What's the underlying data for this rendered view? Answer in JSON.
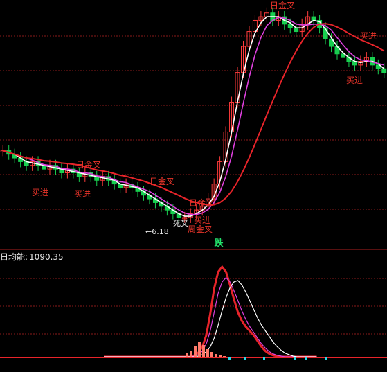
{
  "colors": {
    "background": "#000000",
    "grid": "#8a1a1a",
    "up_candle": "#ff3b3b",
    "down_candle": "#18d050",
    "white_line": "#ffffff",
    "magenta_line": "#e040e0",
    "red_line": "#e8242a",
    "label_red": "#e8342a",
    "volume_bar": "#ff7a6a",
    "volume_neg": "#2ad8e8",
    "marker_green": "#22e06a"
  },
  "indicator": {
    "name": "日均能:",
    "value": "1090.35"
  },
  "marker": {
    "text": "跌"
  },
  "annotations": {
    "low_price": "←6.18",
    "golden_cross": "日金叉",
    "weekly_golden_cross": "周金叉",
    "buy": "买进",
    "death_cross": "死叉"
  },
  "chart_data": [
    {
      "type": "candlestick",
      "title": "",
      "series": [
        {
          "name": "",
          "color": "white_line"
        },
        {
          "name": "",
          "color": "magenta_line"
        },
        {
          "name": "",
          "color": "red_line"
        }
      ],
      "close": [
        8.1,
        8.0,
        7.9,
        7.8,
        7.7,
        7.8,
        7.7,
        7.6,
        7.7,
        7.6,
        7.5,
        7.6,
        7.5,
        7.4,
        7.5,
        7.4,
        7.3,
        7.4,
        7.3,
        7.2,
        7.1,
        7.2,
        7.1,
        7.0,
        6.9,
        6.8,
        6.7,
        6.6,
        6.5,
        6.4,
        6.3,
        6.3,
        6.4,
        6.5,
        6.6,
        6.8,
        7.2,
        7.8,
        8.6,
        9.4,
        10.2,
        10.9,
        11.3,
        11.6,
        11.7,
        11.8,
        11.6,
        11.7,
        11.5,
        11.4,
        11.3,
        11.5,
        11.7,
        11.6,
        11.4,
        11.1,
        10.9,
        10.7,
        10.6,
        10.5,
        10.4,
        10.5,
        10.6,
        10.4,
        10.3,
        10.2
      ],
      "low_marked": "6.18"
    },
    {
      "type": "line",
      "title": "",
      "indicator_value": "1090.35",
      "series": [
        {
          "name": "",
          "color": "red_line",
          "values": [
            0,
            0,
            0,
            0,
            0,
            0,
            0,
            0,
            0,
            0,
            0,
            0,
            0,
            0,
            0,
            0,
            0,
            0,
            0,
            0,
            0,
            0,
            0,
            2,
            6,
            14,
            30,
            60,
            95,
            118,
            125,
            118,
            100,
            80,
            62,
            50,
            42,
            36,
            30,
            22,
            14,
            8,
            4,
            2,
            1,
            0,
            0,
            0,
            0,
            0,
            0,
            0,
            0,
            0,
            0
          ]
        },
        {
          "name": "",
          "color": "magenta_line",
          "values": [
            0,
            0,
            0,
            0,
            0,
            0,
            0,
            0,
            0,
            0,
            0,
            0,
            0,
            0,
            0,
            0,
            0,
            0,
            0,
            0,
            0,
            0,
            0,
            1,
            3,
            8,
            18,
            36,
            62,
            88,
            104,
            110,
            104,
            92,
            78,
            64,
            52,
            42,
            34,
            26,
            18,
            12,
            7,
            4,
            2,
            1,
            0,
            0,
            0,
            0,
            0,
            0,
            0,
            0,
            0
          ]
        },
        {
          "name": "",
          "color": "white_line",
          "values": [
            0,
            0,
            0,
            0,
            0,
            0,
            0,
            0,
            0,
            0,
            0,
            0,
            0,
            0,
            0,
            0,
            0,
            0,
            0,
            0,
            0,
            0,
            0,
            0,
            1,
            3,
            7,
            14,
            26,
            44,
            64,
            82,
            96,
            104,
            106,
            100,
            90,
            78,
            66,
            54,
            44,
            36,
            28,
            20,
            14,
            9,
            5,
            3,
            1,
            0,
            0,
            0,
            0,
            0,
            0
          ]
        }
      ]
    }
  ]
}
